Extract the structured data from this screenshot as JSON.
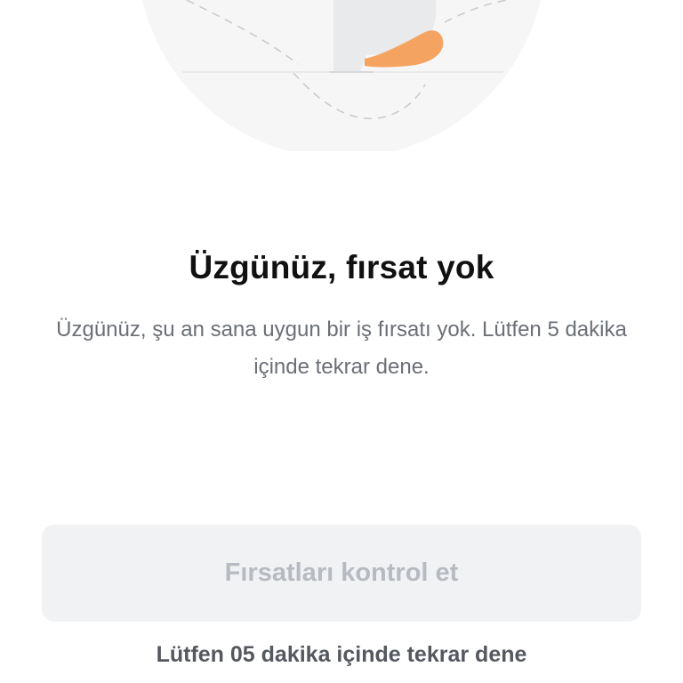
{
  "empty_state": {
    "title": "Üzgünüz, fırsat yok",
    "message": "Üzgünüz, şu an sana uygun bir iş fırsatı yok. Lütfen 5 dakika içinde tekrar dene."
  },
  "actions": {
    "check_button_label": "Fırsatları kontrol et",
    "retry_note": "Lütfen 05 dakika içinde tekrar dene"
  },
  "colors": {
    "background": "#ffffff",
    "title": "#111111",
    "message": "#6b6f76",
    "button_bg_disabled": "#f1f2f4",
    "button_text_disabled": "#b7bbc1",
    "note": "#55595f",
    "illustration_skin": "#f4a460"
  },
  "icons": {
    "illustration": "person-waiting-illustration"
  }
}
